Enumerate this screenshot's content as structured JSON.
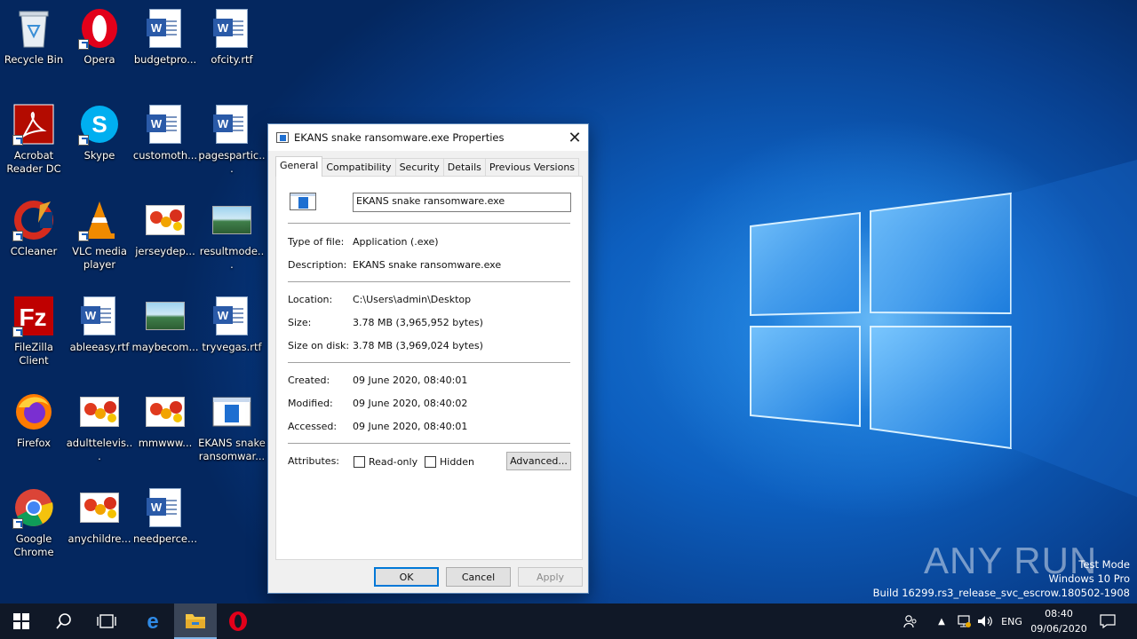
{
  "desktop": {
    "icons": [
      {
        "label": "Recycle Bin"
      },
      {
        "label": "Opera"
      },
      {
        "label": "budgetpro..."
      },
      {
        "label": "ofcity.rtf"
      },
      {
        "label": "Acrobat Reader DC"
      },
      {
        "label": "Skype"
      },
      {
        "label": "customoth..."
      },
      {
        "label": "pagespartic..."
      },
      {
        "label": "CCleaner"
      },
      {
        "label": "VLC media player"
      },
      {
        "label": "jerseydep..."
      },
      {
        "label": "resultmode..."
      },
      {
        "label": "FileZilla Client"
      },
      {
        "label": "ableeasy.rtf"
      },
      {
        "label": "maybecom..."
      },
      {
        "label": "tryvegas.rtf"
      },
      {
        "label": "Firefox"
      },
      {
        "label": "adulttelevis..."
      },
      {
        "label": "mmwww..."
      },
      {
        "label": "EKANS snake ransomwar..."
      },
      {
        "label": "Google Chrome"
      },
      {
        "label": "anychildre..."
      },
      {
        "label": "needperce..."
      }
    ]
  },
  "dialog": {
    "title": "EKANS snake ransomware.exe Properties",
    "tabs": [
      {
        "label": "General"
      },
      {
        "label": "Compatibility"
      },
      {
        "label": "Security"
      },
      {
        "label": "Details"
      },
      {
        "label": "Previous Versions"
      }
    ],
    "file_name": "EKANS snake ransomware.exe",
    "type_label": "Type of file:",
    "type_value": "Application (.exe)",
    "desc_label": "Description:",
    "desc_value": "EKANS snake ransomware.exe",
    "location_label": "Location:",
    "location_value": "C:\\Users\\admin\\Desktop",
    "size_label": "Size:",
    "size_value": "3.78 MB (3,965,952 bytes)",
    "size_on_disk_label": "Size on disk:",
    "size_on_disk_value": "3.78 MB (3,969,024 bytes)",
    "created_label": "Created:",
    "created_value": "09 June 2020, 08:40:01",
    "modified_label": "Modified:",
    "modified_value": "09 June 2020, 08:40:02",
    "accessed_label": "Accessed:",
    "accessed_value": "09 June 2020, 08:40:01",
    "attributes_label": "Attributes:",
    "readonly_label": "Read-only",
    "hidden_label": "Hidden",
    "advanced_label": "Advanced...",
    "ok_label": "OK",
    "cancel_label": "Cancel",
    "apply_label": "Apply"
  },
  "watermark": {
    "line1": "Test Mode",
    "line2": "Windows 10 Pro",
    "line3": "Build 16299.rs3_release_svc_escrow.180502-1908",
    "brand": "ANY RUN"
  },
  "taskbar": {
    "language": "ENG",
    "time": "08:40",
    "date": "09/06/2020"
  }
}
